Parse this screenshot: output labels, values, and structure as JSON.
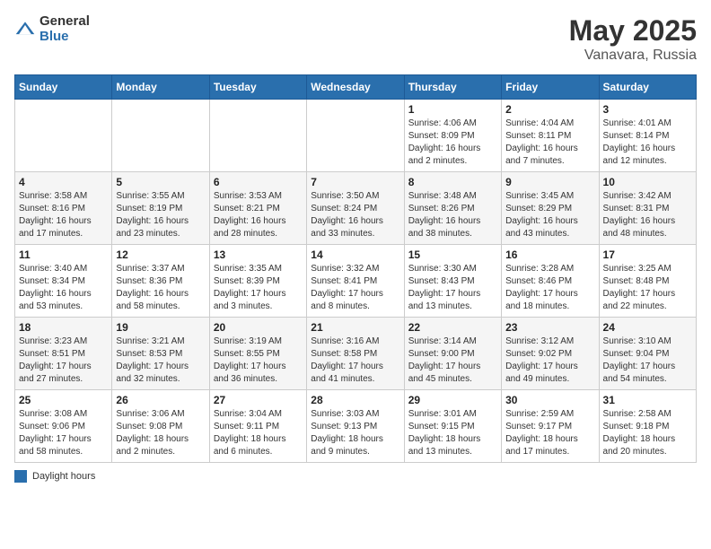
{
  "header": {
    "logo_general": "General",
    "logo_blue": "Blue",
    "title": "May 2025",
    "subtitle": "Vanavara, Russia"
  },
  "days_of_week": [
    "Sunday",
    "Monday",
    "Tuesday",
    "Wednesday",
    "Thursday",
    "Friday",
    "Saturday"
  ],
  "weeks": [
    [
      {
        "day": "",
        "info": ""
      },
      {
        "day": "",
        "info": ""
      },
      {
        "day": "",
        "info": ""
      },
      {
        "day": "",
        "info": ""
      },
      {
        "day": "1",
        "info": "Sunrise: 4:06 AM\nSunset: 8:09 PM\nDaylight: 16 hours\nand 2 minutes."
      },
      {
        "day": "2",
        "info": "Sunrise: 4:04 AM\nSunset: 8:11 PM\nDaylight: 16 hours\nand 7 minutes."
      },
      {
        "day": "3",
        "info": "Sunrise: 4:01 AM\nSunset: 8:14 PM\nDaylight: 16 hours\nand 12 minutes."
      }
    ],
    [
      {
        "day": "4",
        "info": "Sunrise: 3:58 AM\nSunset: 8:16 PM\nDaylight: 16 hours\nand 17 minutes."
      },
      {
        "day": "5",
        "info": "Sunrise: 3:55 AM\nSunset: 8:19 PM\nDaylight: 16 hours\nand 23 minutes."
      },
      {
        "day": "6",
        "info": "Sunrise: 3:53 AM\nSunset: 8:21 PM\nDaylight: 16 hours\nand 28 minutes."
      },
      {
        "day": "7",
        "info": "Sunrise: 3:50 AM\nSunset: 8:24 PM\nDaylight: 16 hours\nand 33 minutes."
      },
      {
        "day": "8",
        "info": "Sunrise: 3:48 AM\nSunset: 8:26 PM\nDaylight: 16 hours\nand 38 minutes."
      },
      {
        "day": "9",
        "info": "Sunrise: 3:45 AM\nSunset: 8:29 PM\nDaylight: 16 hours\nand 43 minutes."
      },
      {
        "day": "10",
        "info": "Sunrise: 3:42 AM\nSunset: 8:31 PM\nDaylight: 16 hours\nand 48 minutes."
      }
    ],
    [
      {
        "day": "11",
        "info": "Sunrise: 3:40 AM\nSunset: 8:34 PM\nDaylight: 16 hours\nand 53 minutes."
      },
      {
        "day": "12",
        "info": "Sunrise: 3:37 AM\nSunset: 8:36 PM\nDaylight: 16 hours\nand 58 minutes."
      },
      {
        "day": "13",
        "info": "Sunrise: 3:35 AM\nSunset: 8:39 PM\nDaylight: 17 hours\nand 3 minutes."
      },
      {
        "day": "14",
        "info": "Sunrise: 3:32 AM\nSunset: 8:41 PM\nDaylight: 17 hours\nand 8 minutes."
      },
      {
        "day": "15",
        "info": "Sunrise: 3:30 AM\nSunset: 8:43 PM\nDaylight: 17 hours\nand 13 minutes."
      },
      {
        "day": "16",
        "info": "Sunrise: 3:28 AM\nSunset: 8:46 PM\nDaylight: 17 hours\nand 18 minutes."
      },
      {
        "day": "17",
        "info": "Sunrise: 3:25 AM\nSunset: 8:48 PM\nDaylight: 17 hours\nand 22 minutes."
      }
    ],
    [
      {
        "day": "18",
        "info": "Sunrise: 3:23 AM\nSunset: 8:51 PM\nDaylight: 17 hours\nand 27 minutes."
      },
      {
        "day": "19",
        "info": "Sunrise: 3:21 AM\nSunset: 8:53 PM\nDaylight: 17 hours\nand 32 minutes."
      },
      {
        "day": "20",
        "info": "Sunrise: 3:19 AM\nSunset: 8:55 PM\nDaylight: 17 hours\nand 36 minutes."
      },
      {
        "day": "21",
        "info": "Sunrise: 3:16 AM\nSunset: 8:58 PM\nDaylight: 17 hours\nand 41 minutes."
      },
      {
        "day": "22",
        "info": "Sunrise: 3:14 AM\nSunset: 9:00 PM\nDaylight: 17 hours\nand 45 minutes."
      },
      {
        "day": "23",
        "info": "Sunrise: 3:12 AM\nSunset: 9:02 PM\nDaylight: 17 hours\nand 49 minutes."
      },
      {
        "day": "24",
        "info": "Sunrise: 3:10 AM\nSunset: 9:04 PM\nDaylight: 17 hours\nand 54 minutes."
      }
    ],
    [
      {
        "day": "25",
        "info": "Sunrise: 3:08 AM\nSunset: 9:06 PM\nDaylight: 17 hours\nand 58 minutes."
      },
      {
        "day": "26",
        "info": "Sunrise: 3:06 AM\nSunset: 9:08 PM\nDaylight: 18 hours\nand 2 minutes."
      },
      {
        "day": "27",
        "info": "Sunrise: 3:04 AM\nSunset: 9:11 PM\nDaylight: 18 hours\nand 6 minutes."
      },
      {
        "day": "28",
        "info": "Sunrise: 3:03 AM\nSunset: 9:13 PM\nDaylight: 18 hours\nand 9 minutes."
      },
      {
        "day": "29",
        "info": "Sunrise: 3:01 AM\nSunset: 9:15 PM\nDaylight: 18 hours\nand 13 minutes."
      },
      {
        "day": "30",
        "info": "Sunrise: 2:59 AM\nSunset: 9:17 PM\nDaylight: 18 hours\nand 17 minutes."
      },
      {
        "day": "31",
        "info": "Sunrise: 2:58 AM\nSunset: 9:18 PM\nDaylight: 18 hours\nand 20 minutes."
      }
    ]
  ],
  "legend": {
    "box_label": "Daylight hours"
  }
}
